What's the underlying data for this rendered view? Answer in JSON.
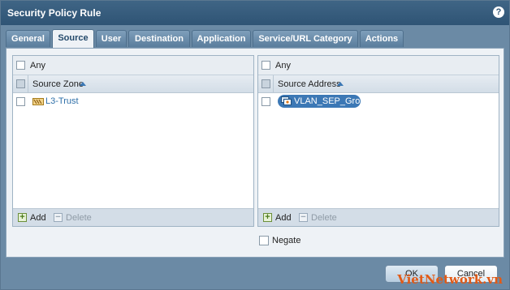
{
  "window": {
    "title": "Security Policy Rule",
    "help_glyph": "?"
  },
  "tabs": [
    {
      "label": "General"
    },
    {
      "label": "Source"
    },
    {
      "label": "User"
    },
    {
      "label": "Destination"
    },
    {
      "label": "Application"
    },
    {
      "label": "Service/URL Category"
    },
    {
      "label": "Actions"
    }
  ],
  "active_tab": "Source",
  "zone_panel": {
    "any_label": "Any",
    "any_checked": false,
    "column_header": "Source Zone",
    "sort": "ascending",
    "items": [
      {
        "label": "L3-Trust",
        "icon": "zone-icon"
      }
    ],
    "add_label": "Add",
    "delete_label": "Delete"
  },
  "address_panel": {
    "any_label": "Any",
    "any_checked": false,
    "column_header": "Source Address",
    "sort": "ascending",
    "items": [
      {
        "label": "VLAN_SEP_Group",
        "icon": "address-group-icon"
      }
    ],
    "add_label": "Add",
    "delete_label": "Delete"
  },
  "negate": {
    "label": "Negate",
    "checked": false
  },
  "buttons": {
    "ok": "OK",
    "cancel": "Cancel"
  },
  "watermark": "VietNetwork.vn",
  "colors": {
    "accent": "#3c78b5",
    "titlebar": "#2f5475",
    "watermark": "#e25a16"
  }
}
